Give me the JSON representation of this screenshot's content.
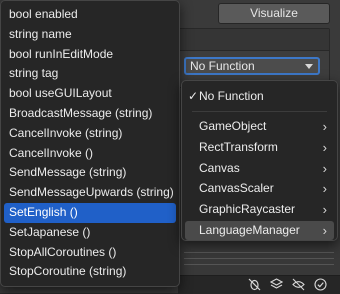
{
  "inspector": {
    "visualize_label": "Visualize",
    "function_dropdown_value": "No Function"
  },
  "method_popup": {
    "items": [
      {
        "label": "bool enabled"
      },
      {
        "label": "string name"
      },
      {
        "label": "bool runInEditMode"
      },
      {
        "label": "string tag"
      },
      {
        "label": "bool useGUILayout"
      },
      {
        "label": "BroadcastMessage (string)"
      },
      {
        "label": "CancelInvoke (string)"
      },
      {
        "label": "CancelInvoke ()"
      },
      {
        "label": "SendMessage (string)"
      },
      {
        "label": "SendMessageUpwards (string)"
      },
      {
        "label": "SetEnglish ()"
      },
      {
        "label": "SetJapanese ()"
      },
      {
        "label": "StopAllCoroutines ()"
      },
      {
        "label": "StopCoroutine (string)"
      }
    ],
    "selected_label": "SetEnglish ()"
  },
  "component_menu": {
    "checked_item": "No Function",
    "check_glyph": "✓",
    "chevron_glyph": "›",
    "items": [
      {
        "label": "GameObject"
      },
      {
        "label": "RectTransform"
      },
      {
        "label": "Canvas"
      },
      {
        "label": "CanvasScaler"
      },
      {
        "label": "GraphicRaycaster"
      },
      {
        "label": "LanguageManager"
      }
    ],
    "highlighted_item": "LanguageManager"
  },
  "colors": {
    "selection_blue": "#2060c8",
    "menu_bg": "#262626",
    "focus_border": "#3d78c8"
  }
}
